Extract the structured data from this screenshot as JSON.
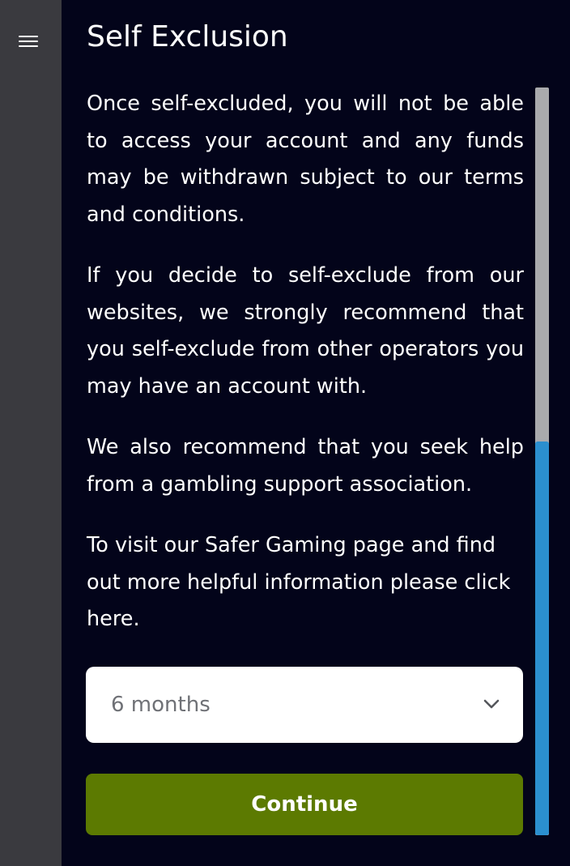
{
  "sidebar": {
    "menu_icon": "hamburger-menu-icon"
  },
  "header": {
    "title": "Self Exclusion"
  },
  "content": {
    "paragraphs": [
      "Once self-excluded, you will not be able to access your account and any funds may be withdrawn subject to our terms and conditions.",
      "If you decide to self-exclude from our websites, we strongly recommend that you self-exclude from other operators you may have an account with.",
      "We also recommend that you seek help from a gambling support association.",
      "To visit our Safer Gaming page and find out more helpful information please click here."
    ]
  },
  "duration_select": {
    "selected": "6 months",
    "icon": "chevron-down-icon"
  },
  "actions": {
    "continue_label": "Continue"
  },
  "colors": {
    "background": "#03041a",
    "sidebar": "#3a3a3f",
    "button": "#5c7a01",
    "scroll_thumb": "#2b8fcf",
    "scroll_track": "#a9aaad",
    "select_text": "#6f7176"
  }
}
